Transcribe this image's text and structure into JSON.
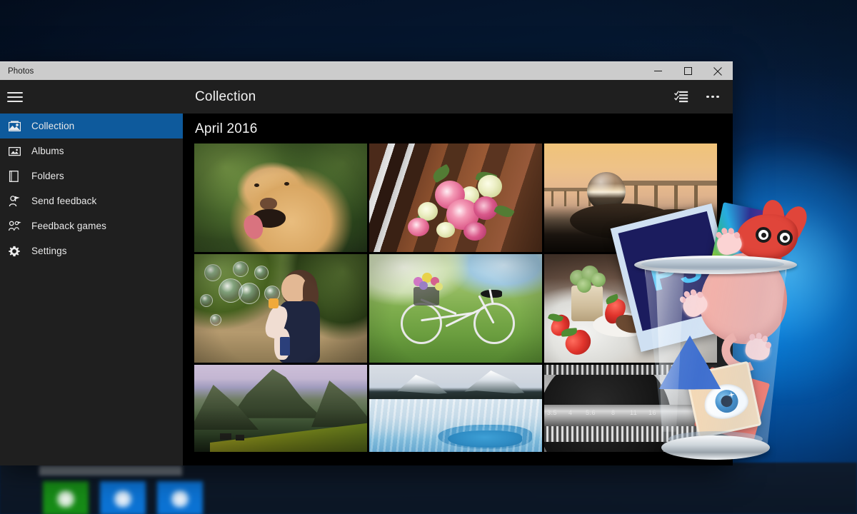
{
  "window": {
    "app_title": "Photos",
    "controls": [
      {
        "name": "minimize",
        "glyph": "minimize-icon"
      },
      {
        "name": "maximize",
        "glyph": "maximize-icon"
      },
      {
        "name": "close",
        "glyph": "close-icon"
      }
    ]
  },
  "sidebar": {
    "menu_icon": "hamburger-icon",
    "items": [
      {
        "label": "Collection",
        "icon": "collection-icon",
        "active": true
      },
      {
        "label": "Albums",
        "icon": "albums-icon",
        "active": false
      },
      {
        "label": "Folders",
        "icon": "folders-icon",
        "active": false
      },
      {
        "label": "Send feedback",
        "icon": "send-feedback-icon",
        "active": false
      },
      {
        "label": "Feedback games",
        "icon": "feedback-games-icon",
        "active": false
      },
      {
        "label": "Settings",
        "icon": "gear-icon",
        "active": false
      }
    ]
  },
  "content": {
    "header_title": "Collection",
    "section_title": "April 2016",
    "actions": [
      {
        "name": "select-icon",
        "label": "Select"
      },
      {
        "name": "more-options-icon",
        "label": "See more"
      }
    ],
    "photos": [
      {
        "name": "dog-photo",
        "alt": "Yellow labrador dog"
      },
      {
        "name": "roses-photo",
        "alt": "Pink and cream roses on a wooden bench"
      },
      {
        "name": "pier-photo",
        "alt": "Crystal sphere at a pier at sunset"
      },
      {
        "name": "bubbles-photo",
        "alt": "Child blowing soap bubbles on a path"
      },
      {
        "name": "bicycle-photo",
        "alt": "White bicycle with flower basket in a meadow"
      },
      {
        "name": "strawberries-photo",
        "alt": "Strawberries and dessert on a plate"
      },
      {
        "name": "mountain-photo",
        "alt": "Green mountain landscape with yellow fields"
      },
      {
        "name": "glacier-photo",
        "alt": "Glacier and snowy mountains"
      },
      {
        "name": "camera-photo",
        "alt": "Close-up of a camera lens aperture ring"
      }
    ],
    "lens_markings": [
      "3.5",
      "4",
      "5.6",
      "8",
      "11",
      "16"
    ]
  },
  "overlay": {
    "bin": {
      "name": "recycle-bin",
      "label": "Recycle Bin"
    },
    "items": [
      {
        "name": "photoshop-icon",
        "label": "Ps"
      },
      {
        "name": "rainbow-burst-icon",
        "label": "Rainbow burst"
      },
      {
        "name": "pink-creature-icon",
        "label": "Pink creature mascot"
      },
      {
        "name": "recycle-symbol-icon",
        "label": "Recycle"
      },
      {
        "name": "eye-viewer-icon",
        "label": "Image viewer eye"
      }
    ]
  },
  "taskbar": {
    "tiles": [
      {
        "name": "taskbar-tile-green",
        "color": "#178c17"
      },
      {
        "name": "taskbar-tile-blue-1",
        "color": "#0c73d4"
      },
      {
        "name": "taskbar-tile-blue-2",
        "color": "#0c73d4"
      }
    ]
  },
  "colors": {
    "accent": "#0e5a9c",
    "sidebar_bg": "#1f1f1f",
    "content_bg": "#000000",
    "titlebar_bg": "#cccccc",
    "desktop_top": "#041024",
    "desktop_glow": "#0096ff"
  }
}
